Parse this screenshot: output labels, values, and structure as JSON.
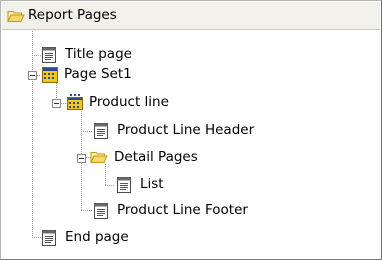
{
  "panel_title": "Report Pages",
  "tree": [
    {
      "id": "title",
      "label": "Title page",
      "icon": "page-icon"
    },
    {
      "id": "pageset1",
      "label": "Page Set1",
      "icon": "page-set-icon",
      "expanded": true
    },
    {
      "id": "productline",
      "label": "Product line",
      "icon": "group-set-icon",
      "expanded": true
    },
    {
      "id": "plheader",
      "label": "Product Line Header",
      "icon": "page-icon"
    },
    {
      "id": "details",
      "label": "Detail Pages",
      "icon": "folder-icon",
      "expanded": true
    },
    {
      "id": "list",
      "label": "List",
      "icon": "page-icon"
    },
    {
      "id": "plfooter",
      "label": "Product Line Footer",
      "icon": "page-icon"
    },
    {
      "id": "end",
      "label": "End page",
      "icon": "page-icon"
    }
  ]
}
